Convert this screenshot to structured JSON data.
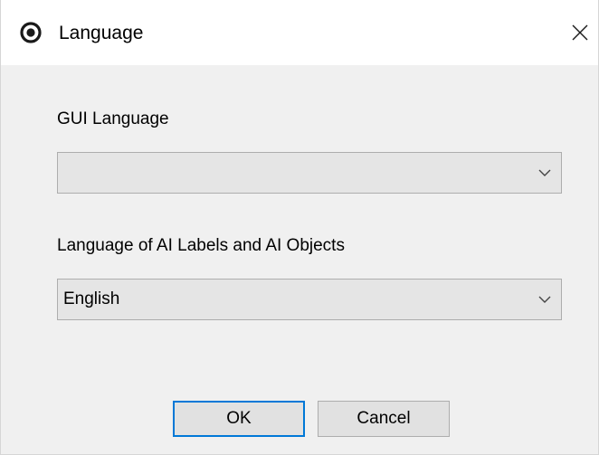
{
  "window": {
    "title": "Language",
    "icon": "app-logo-icon",
    "close_icon": "close-icon"
  },
  "gui_language": {
    "label": "GUI Language",
    "value": ""
  },
  "ai_language": {
    "label": "Language of AI Labels and AI Objects",
    "value": "English"
  },
  "buttons": {
    "ok_label": "OK",
    "cancel_label": "Cancel"
  },
  "colors": {
    "dialog_bg": "#f0f0f0",
    "titlebar_bg": "#ffffff",
    "combo_bg": "#e5e5e5",
    "button_bg": "#e1e1e1",
    "focus_border": "#0078d7"
  }
}
